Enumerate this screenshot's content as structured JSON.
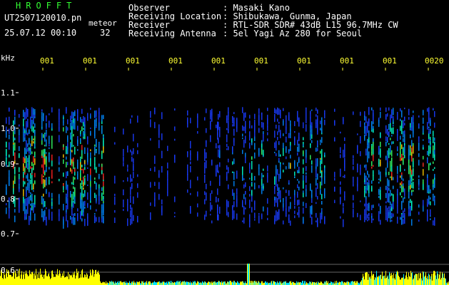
{
  "header": {
    "app_title": "HROFFT",
    "filename": "UT2507120010.pn",
    "mode_label": "meteor",
    "datetime": "25.07.12 00:10",
    "count": "32",
    "fields": [
      {
        "label": "Observer",
        "value": ": Masaki Kano"
      },
      {
        "label": "Receiving Location",
        "value": ": Shibukawa, Gunma, Japan"
      },
      {
        "label": "Receiver",
        "value": ": RTL-SDR SDR# 43dB L15 96.7MHz CW"
      },
      {
        "label": "Receiving Antenna",
        "value": ": 5el Yagi Az 280 for Seoul"
      }
    ]
  },
  "axis": {
    "unit": "kHz",
    "y_ticks": [
      "1.1",
      "1.0",
      "0.9",
      "0.8",
      "0.7",
      "0.6"
    ],
    "x_ticks": [
      "001",
      "001",
      "001",
      "001",
      "001",
      "001",
      "001",
      "001",
      "001",
      "0020"
    ]
  },
  "colors": {
    "background": "#000000",
    "header_text": "#ffffff",
    "title_green": "#33ff33",
    "tick_yellow": "#ffff33",
    "signal_low": "#1a3cff",
    "signal_mid": "#00ffcc",
    "signal_high": "#ff2020",
    "level_yellow": "#ffff00",
    "level_cyan": "#00e5ff"
  }
}
